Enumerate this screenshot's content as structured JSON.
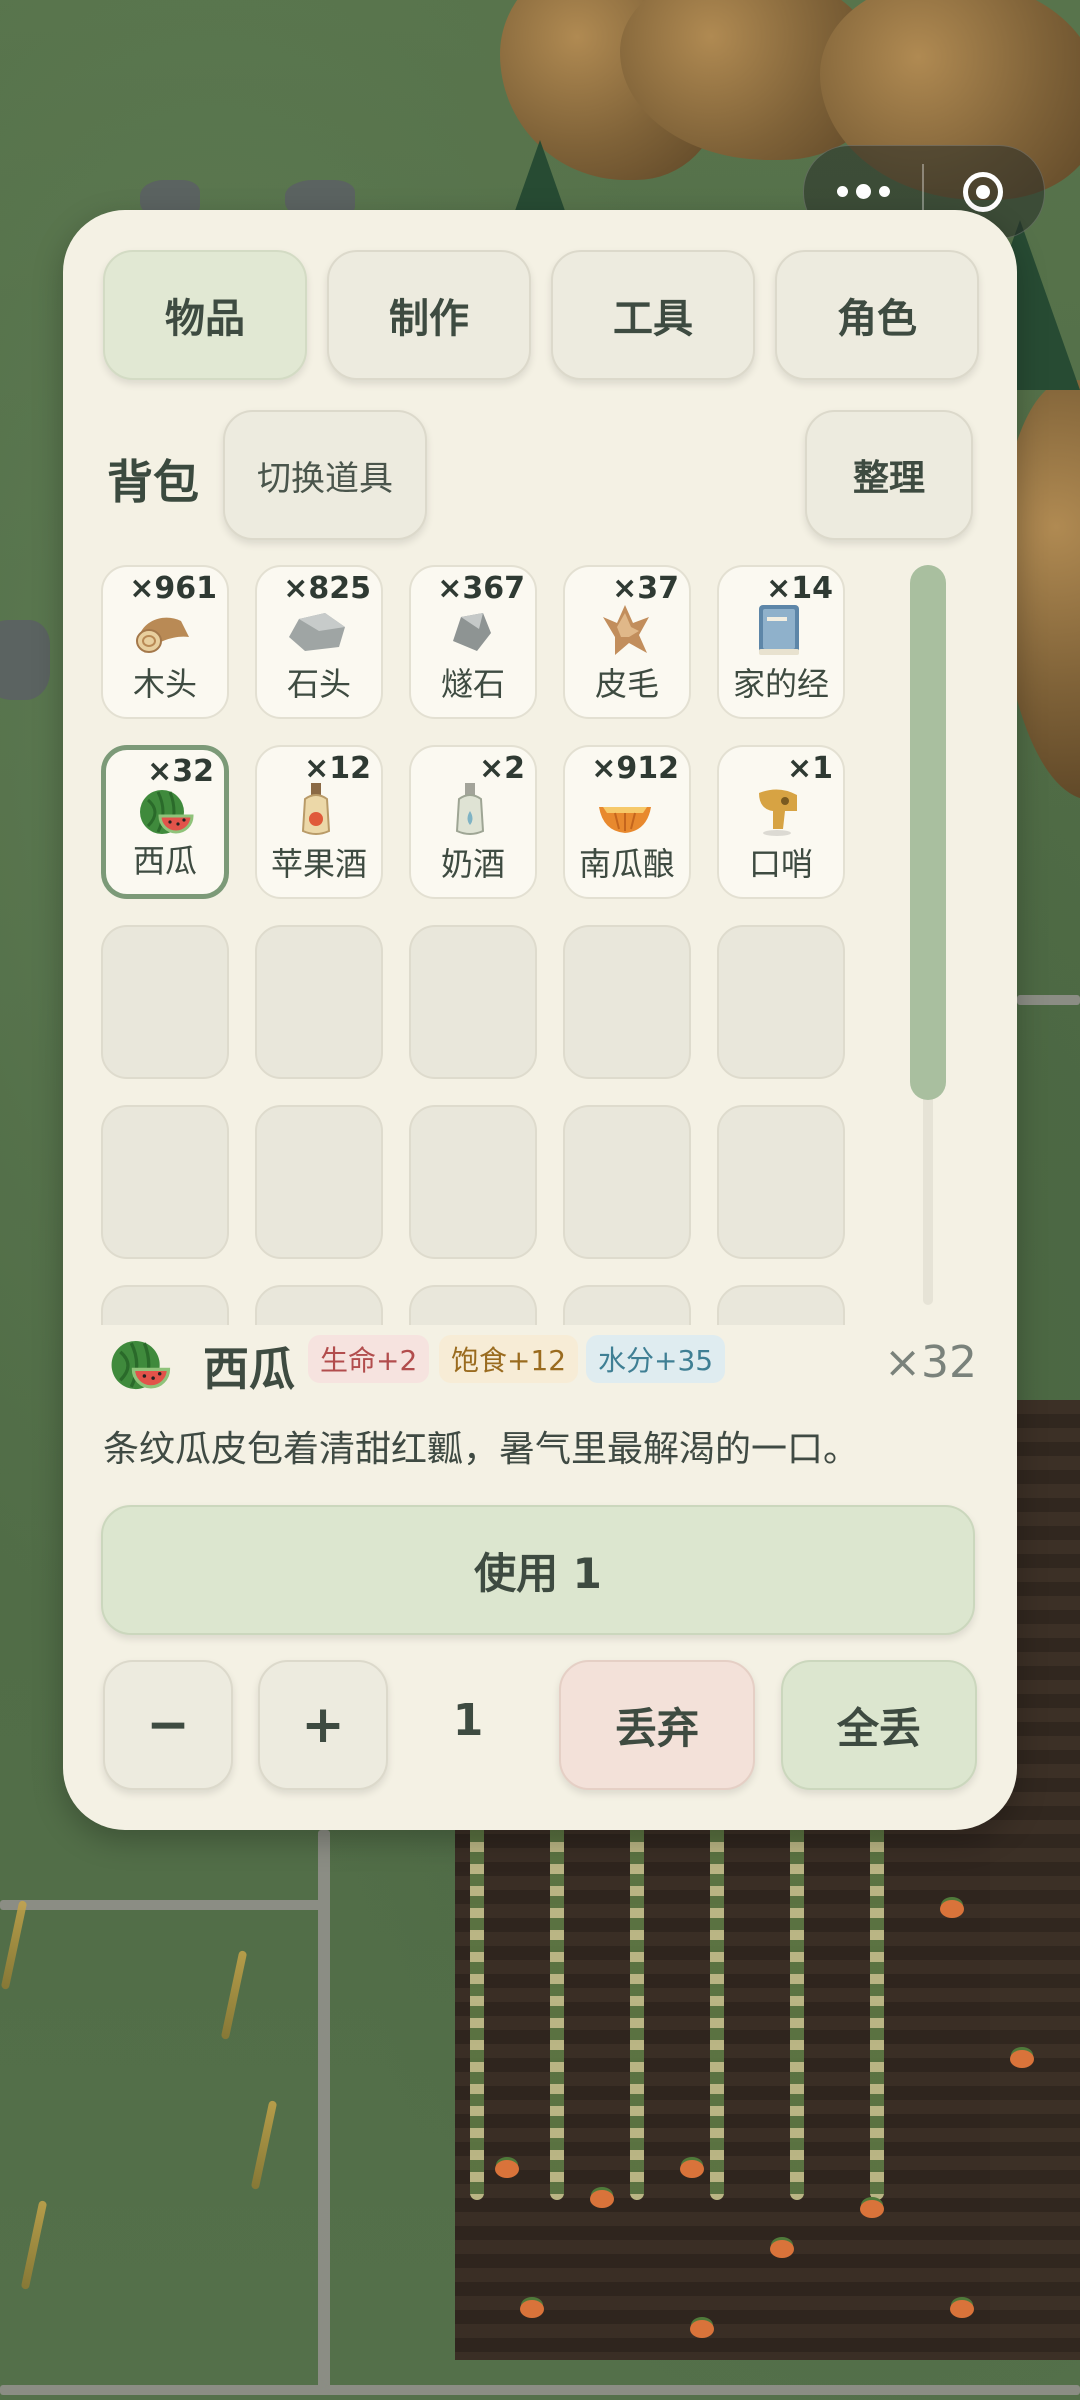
{
  "tabs": [
    {
      "label": "物品",
      "active": true
    },
    {
      "label": "制作",
      "active": false
    },
    {
      "label": "工具",
      "active": false
    },
    {
      "label": "角色",
      "active": false
    }
  ],
  "bag": {
    "title": "背包",
    "switch_label": "切换道具",
    "sort_label": "整理"
  },
  "items": [
    {
      "name": "木头",
      "qty": "×961",
      "icon": "wood-icon"
    },
    {
      "name": "石头",
      "qty": "×825",
      "icon": "stone-icon"
    },
    {
      "name": "燧石",
      "qty": "×367",
      "icon": "flint-icon"
    },
    {
      "name": "皮毛",
      "qty": "×37",
      "icon": "fur-icon"
    },
    {
      "name": "家的经",
      "qty": "×14",
      "icon": "book-icon"
    },
    {
      "name": "西瓜",
      "qty": "×32",
      "icon": "watermelon-icon"
    },
    {
      "name": "苹果酒",
      "qty": "×12",
      "icon": "cider-icon"
    },
    {
      "name": "奶酒",
      "qty": "×2",
      "icon": "milk-wine-icon"
    },
    {
      "name": "南瓜酿",
      "qty": "×912",
      "icon": "pumpkin-brew-icon"
    },
    {
      "name": "口哨",
      "qty": "×1",
      "icon": "whistle-icon"
    }
  ],
  "selected_item": {
    "name": "西瓜",
    "count": "×32",
    "effects": {
      "hp": "生命+2",
      "food": "饱食+12",
      "water": "水分+35"
    },
    "description": "条纹瓜皮包着清甜红瓤，暑气里最解渴的一口。"
  },
  "actions": {
    "use_label": "使用 1",
    "minus_label": "−",
    "plus_label": "+",
    "amount": "1",
    "discard_label": "丢弃",
    "discard_all_label": "全丢"
  },
  "colors": {
    "panel": "#f4f1e4",
    "accent": "#7c9a78",
    "active_tab": "#e1e8d3"
  }
}
